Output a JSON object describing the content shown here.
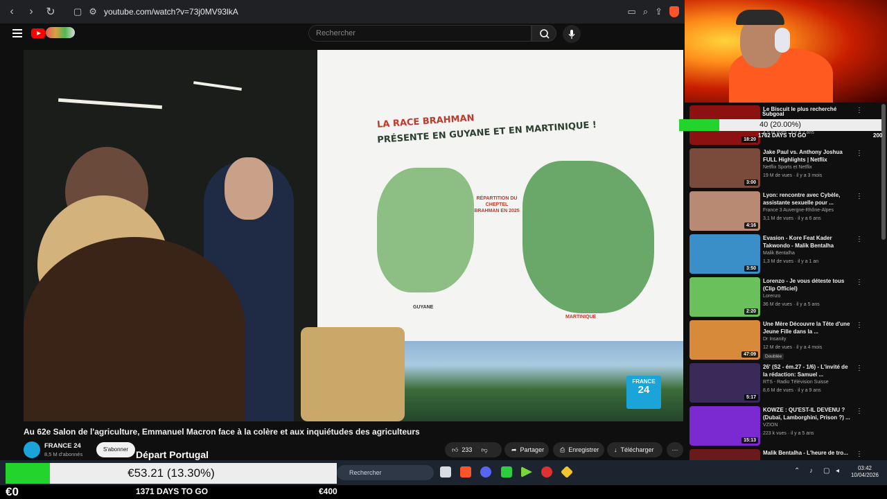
{
  "browser": {
    "url": "youtube.com/watch?v=73j0MV93lkA"
  },
  "yt_header": {
    "search_placeholder": "Rechercher"
  },
  "video": {
    "board_title_line1": "LA RACE BRAHMAN",
    "board_title_line2": "PRÉSENTE EN GUYANE ET EN MARTINIQUE !",
    "board_legend": "RÉPARTITION DU CHEPTEL BRAHMAN EN 2025",
    "label_guyane": "GUYANE",
    "label_martinique": "MARTINIQUE",
    "logo_line1": "FRANCE",
    "logo_line2": "24",
    "title": "Au 62e Salon de l'agriculture, Emmanuel Macron face à la colère et aux inquiétudes des agriculteurs",
    "channel_name": "FRANCE 24",
    "channel_subs": "8,5 M d'abonnés",
    "subscribe_label": "S'abonner",
    "like_count": "233",
    "share_label": "Partager",
    "save_label": "Enregistrer",
    "download_label": "Télécharger"
  },
  "overlay": {
    "depart_label": "Départ Portugal",
    "goal_label": "Subgoal",
    "goal_text": "40 (20.00%)",
    "goal_progress": 0.2,
    "goal_days": "1762 DAYS TO GO",
    "goal_max": "200",
    "money_text": "€53.21 (13.30%)",
    "money_progress": 0.133,
    "money_start": "€0",
    "money_days": "1371 DAYS TO GO",
    "money_goal": "€400"
  },
  "recommendations": [
    {
      "title": "Le Biscuit le plus recherché",
      "channel": "",
      "meta": "4,5 M vues · il y a 2 ans",
      "duration": "18:20",
      "thumb_color": "#8e1111",
      "badge": ""
    },
    {
      "title": "Jake Paul vs. Anthony Joshua FULL Highlights | Netflix",
      "channel": "Netflix Sports et Netflix",
      "meta": "19 M de vues · il y a 3 mois",
      "duration": "3:00",
      "thumb_color": "#7a4a3a",
      "badge": ""
    },
    {
      "title": "Lyon: rencontre avec Cybèle, assistante sexuelle pour ...",
      "channel": "France 3 Auvergne-Rhône-Alpes",
      "meta": "3,1 M de vues · il y a 6 ans",
      "duration": "4:16",
      "thumb_color": "#b88a74",
      "badge": ""
    },
    {
      "title": "Evasion - Kore Feat Kader Takwondo - Malik Bentalha",
      "channel": "Malik Bentalha",
      "meta": "1,3 M de vues · il y a 1 an",
      "duration": "3:50",
      "thumb_color": "#3a8fc9",
      "badge": ""
    },
    {
      "title": "Lorenzo - Je vous déteste tous (Clip Officiel)",
      "channel": "Lorenzo",
      "meta": "36 M de vues · il y a 5 ans",
      "duration": "2:20",
      "thumb_color": "#6ac05a",
      "badge": ""
    },
    {
      "title": "Une Mère Découvre la Tête d'une Jeune Fille dans la ...",
      "channel": "Dr Insanity",
      "meta": "12 M de vues · il y a 4 mois",
      "duration": "47:09",
      "thumb_color": "#d68a3a",
      "badge": "Doublée"
    },
    {
      "title": "26' (S2 - ém.27 - 1/6) - L'invité de la rédaction: Samuel ...",
      "channel": "RTS - Radio Télévision Suisse",
      "meta": "8,6 M de vues · il y a 9 ans",
      "duration": "5:17",
      "thumb_color": "#3a2a5a",
      "badge": ""
    },
    {
      "title": "KOWZE : QU'EST-IL DEVENU ? (Dubaï, Lamborghini, Prison ?) ...",
      "channel": "VZION",
      "meta": "223 k vues · il y a 5 ans",
      "duration": "15:13",
      "thumb_color": "#7a2ad0",
      "badge": ""
    },
    {
      "title": "Malik Bentalha - L'heure de tro...",
      "channel": "",
      "meta": "",
      "duration": "",
      "thumb_color": "#6a1a1a",
      "badge": ""
    }
  ],
  "taskbar": {
    "search_placeholder": "Rechercher",
    "time": "03:42",
    "date": "10/04/2026"
  }
}
